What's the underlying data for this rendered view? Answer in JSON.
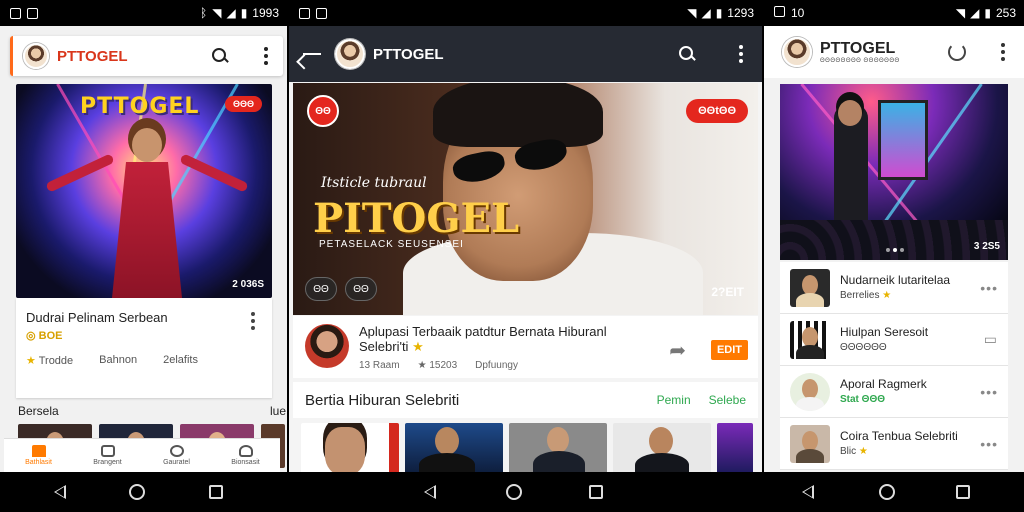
{
  "status_bars": [
    {
      "left_icons": [
        "notification-icon",
        "image-icon"
      ],
      "time": "1993"
    },
    {
      "left_icons": [
        "notification-icon",
        "image-icon"
      ],
      "time": "1293"
    },
    {
      "left_icons": [
        "notification-icon"
      ],
      "left_text": "10",
      "time": "253"
    }
  ],
  "panel1": {
    "app_title": "PTTOGEL",
    "hero": {
      "title": "PTTOGEL",
      "badge": "ΘΘΘ",
      "count": "2 036S"
    },
    "card": {
      "title": "Dudrai Pelinam Serbean",
      "sub": "BOE",
      "meta": [
        "Trodde",
        "Bahnon",
        "2elafits"
      ]
    },
    "section_title": "Bersela",
    "section_right": "lue",
    "tabs": [
      "Bathlasit",
      "Brangent",
      "Gauratel",
      "Bionsasit"
    ]
  },
  "panel2": {
    "app_title": "PTTOGEL",
    "hero": {
      "badge": "ΘΘ",
      "live": "ΘΘtΘΘ",
      "tagline": "Itsticle tubraul",
      "title": "PITOGEL",
      "subtitle": "PETASELACK SEUSENSEI",
      "pills": [
        "ΘΘ",
        "ΘΘ"
      ],
      "count": "2?EIT"
    },
    "card": {
      "title": "Aplupasi Terbaaik patdtur Bernata Hiburanl Selebri'ti",
      "meta": [
        "13 Raam",
        "15203",
        "Dpfuungy"
      ],
      "button": "EDIT"
    },
    "section": {
      "title": "Bertia  Hiburan Selebriti",
      "links": [
        "Pemin",
        "Selebe"
      ]
    }
  },
  "panel3": {
    "app_title": "PTTOGEL",
    "app_sub": "ΘΘΘΘΘΘΘΘ ΘΘΘΘΘΘΘ",
    "hero": {
      "count": "3 2S5"
    },
    "list": [
      {
        "title": "Nudarneik lutaritelaa",
        "sub": "Berrelies"
      },
      {
        "title": "Hiulpan Seresoit",
        "sub": "ΘΘΘΘΘΘ"
      },
      {
        "title": "Aporal Ragmerk",
        "sub": "Stat ΘΘΘ"
      },
      {
        "title": "Coira Tenbua Selebriti",
        "sub": "Blic"
      }
    ]
  },
  "colors": {
    "accent_orange": "#ff7a00",
    "brand_red": "#e4271e",
    "link_green": "#2fa84f",
    "dark_appbar": "#262a33"
  }
}
